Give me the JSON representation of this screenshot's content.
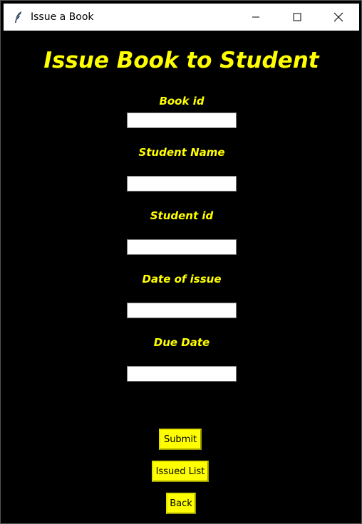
{
  "window": {
    "title": "Issue a Book",
    "icon": "feather-icon"
  },
  "form": {
    "heading": "Issue Book to Student",
    "fields": [
      {
        "label": "Book id",
        "value": ""
      },
      {
        "label": "Student Name",
        "value": ""
      },
      {
        "label": "Student id",
        "value": ""
      },
      {
        "label": "Date of issue",
        "value": ""
      },
      {
        "label": "Due Date",
        "value": ""
      }
    ]
  },
  "buttons": {
    "submit": "Submit",
    "issued_list": "Issued List",
    "back": "Back"
  },
  "colors": {
    "background": "#000000",
    "accent": "#ffff00",
    "input_bg": "#ffffff"
  }
}
